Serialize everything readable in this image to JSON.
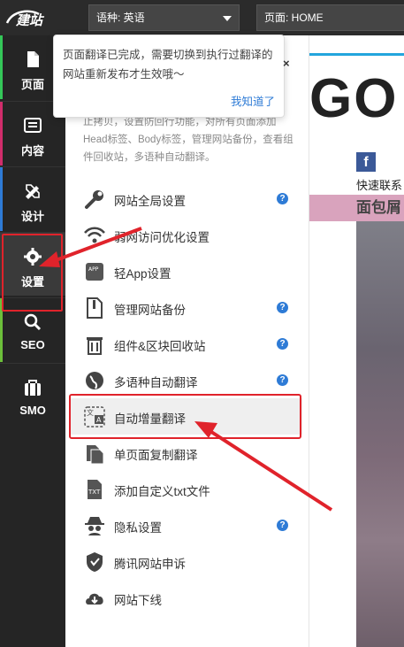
{
  "topbar": {
    "logo_text": "建站",
    "language_select": "语种: 英语",
    "page_select": "页面: HOME"
  },
  "sidebar": {
    "items": [
      {
        "label": "页面",
        "icon": "page-icon",
        "accent": "#34c759"
      },
      {
        "label": "内容",
        "icon": "content-icon",
        "accent": "#d12d6b"
      },
      {
        "label": "设计",
        "icon": "design-icon",
        "accent": "#2e7bd6"
      },
      {
        "label": "设置",
        "icon": "settings-icon",
        "accent": "#e0232b"
      },
      {
        "label": "SEO",
        "icon": "seo-icon",
        "accent": "#6cbf3a"
      },
      {
        "label": "SMO",
        "icon": "smo-icon",
        "accent": ""
      }
    ]
  },
  "tooltip": {
    "text": "页面翻译已完成，需要切换到执行过翻译的网站重新发布才生效哦～",
    "button": "我知道了",
    "close": "×"
  },
  "panel": {
    "description": "止拷贝，设置防回行功能，对所有页面添加Head标签、Body标签，管理网站备份，查看组件回收站，多语种自动翻译。",
    "items": [
      {
        "label": "网站全局设置",
        "icon": "wrench-icon",
        "help": true
      },
      {
        "label": "弱网访问优化设置",
        "icon": "wifi-icon",
        "help": false
      },
      {
        "label": "轻App设置",
        "icon": "app-icon",
        "help": false
      },
      {
        "label": "管理网站备份",
        "icon": "zip-file-icon",
        "help": true
      },
      {
        "label": "组件&区块回收站",
        "icon": "trash-icon",
        "help": true
      },
      {
        "label": "多语种自动翻译",
        "icon": "globe-icon",
        "help": true
      },
      {
        "label": "自动增量翻译",
        "icon": "translate-icon",
        "help": false
      },
      {
        "label": "单页面复制翻译",
        "icon": "copy-page-icon",
        "help": false
      },
      {
        "label": "添加自定义txt文件",
        "icon": "txt-file-icon",
        "help": false
      },
      {
        "label": "隐私设置",
        "icon": "spy-icon",
        "help": true
      },
      {
        "label": "腾讯网站申诉",
        "icon": "tencent-shield-icon",
        "help": false
      },
      {
        "label": "网站下线",
        "icon": "cloud-download-icon",
        "help": false
      }
    ],
    "help_symbol": "?"
  },
  "preview": {
    "logo_text": "GO",
    "fb_letter": "f",
    "contact_text": "快速联系",
    "breadcrumb_text": "面包屑"
  },
  "colors": {
    "highlight_red": "#e0232b",
    "link_blue": "#2e7bd6",
    "topbar_bg": "#2b2b2b",
    "sidebar_bg": "#252525"
  }
}
